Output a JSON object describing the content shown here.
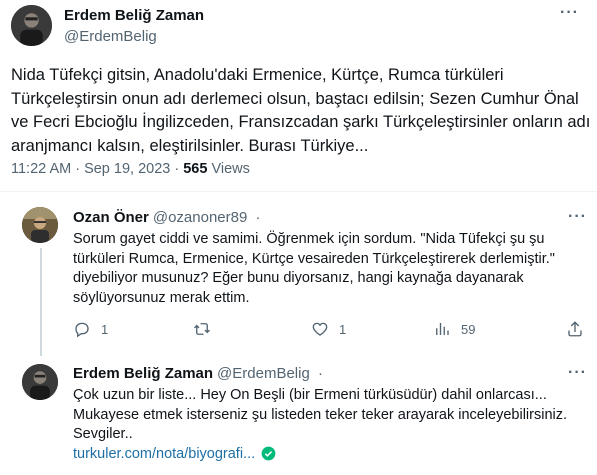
{
  "main_tweet": {
    "author_name": "Erdem Beliğ Zaman",
    "author_handle": "@ErdemBelig",
    "more": "···",
    "text": "Nida Tüfekçi gitsin, Anadolu'daki Ermenice, Kürtçe, Rumca türküleri Türkçeleştirsin onun adı derlemeci olsun, baştacı edilsin; Sezen Cumhur Önal ve Fecri Ebcioğlu İngilizceden, Fransızcadan şarkı Türkçeleştirsinler onların adı aranjmancı kalsın, eleştirilsinler. Burası Türkiye...",
    "time": "11:22 AM · Sep 19, 2023 · ",
    "views_count": "565",
    "views_label": " Views"
  },
  "reply1": {
    "author_name": "Ozan Öner",
    "author_handle": "@ozanoner89",
    "dot": "·",
    "more": "···",
    "text": "Sorum gayet ciddi ve samimi.  Öğrenmek için sordum. \"Nida Tüfekçi şu şu türküleri Rumca, Ermenice, Kürtçe vesaireden Türkçeleştirerek derlemiştir.\" diyebiliyor musunuz? Eğer bunu diyorsanız, hangi kaynağa dayanarak söylüyorsunuz merak ettim.",
    "actions": {
      "reply_count": "1",
      "retweet_count": "",
      "like_count": "1",
      "views_count": "59"
    }
  },
  "reply2": {
    "author_name": "Erdem Beliğ Zaman",
    "author_handle": "@ErdemBelig",
    "dot": "·",
    "more": "···",
    "text": "Çok uzun bir liste... Hey On Beşli (bir Ermeni türküsüdür) dahil onlarcası... Mukayese etmek isterseniz şu listeden teker teker arayarak inceleyebilirsiniz. Sevgiler..",
    "link": "turkuler.com/nota/biyografi..."
  },
  "icons": {
    "reply": "reply-icon",
    "retweet": "retweet-icon",
    "like": "heart-icon",
    "views": "bar-chart-icon",
    "share": "share-icon",
    "verified": "green-check-icon"
  },
  "colors": {
    "link": "#1d6fa5",
    "secondary_text": "#536471",
    "verified": "#00ba7c"
  }
}
